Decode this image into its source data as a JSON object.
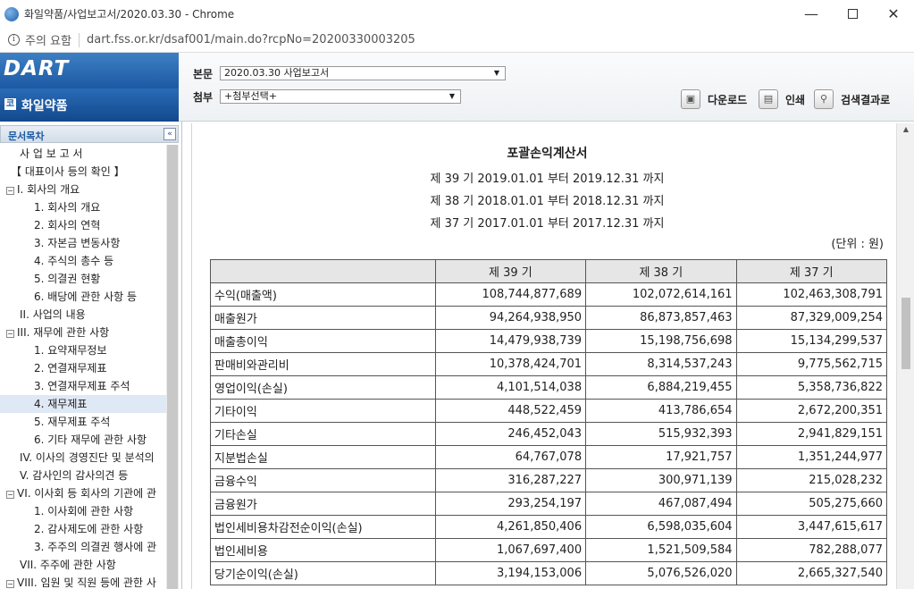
{
  "browser": {
    "title": "화일약품/사업보고서/2020.03.30 - Chrome",
    "security_label": "주의 요함",
    "url": "dart.fss.or.kr/dsaf001/main.do?rcpNo=20200330003205"
  },
  "header": {
    "logo": "DART",
    "company": "화일약품",
    "body_label": "본문",
    "body_select": "2020.03.30 사업보고서",
    "attach_label": "첨부",
    "attach_select": "+첨부선택+",
    "download": "다운로드",
    "print": "인쇄",
    "search_results": "검색결과로"
  },
  "sidebar": {
    "title": "문서목차",
    "items": [
      {
        "label": "사 업 보 고 서",
        "box": ""
      },
      {
        "label": "【 대표이사 등의 확인 】",
        "box": ""
      },
      {
        "label": "I. 회사의 개요",
        "box": "−"
      },
      {
        "label": "1. 회사의 개요",
        "box": ""
      },
      {
        "label": "2. 회사의 연혁",
        "box": ""
      },
      {
        "label": "3. 자본금 변동사항",
        "box": ""
      },
      {
        "label": "4. 주식의 총수 등",
        "box": ""
      },
      {
        "label": "5. 의결권 현황",
        "box": ""
      },
      {
        "label": "6. 배당에 관한 사항 등",
        "box": ""
      },
      {
        "label": "II. 사업의 내용",
        "box": ""
      },
      {
        "label": "III. 재무에 관한 사항",
        "box": "−"
      },
      {
        "label": "1. 요약재무정보",
        "box": ""
      },
      {
        "label": "2. 연결재무제표",
        "box": ""
      },
      {
        "label": "3. 연결재무제표 주석",
        "box": ""
      },
      {
        "label": "4. 재무제표",
        "box": ""
      },
      {
        "label": "5. 재무제표 주석",
        "box": ""
      },
      {
        "label": "6. 기타 재무에 관한 사항",
        "box": ""
      },
      {
        "label": "IV. 이사의 경영진단 및 분석의",
        "box": ""
      },
      {
        "label": "V. 감사인의 감사의견 등",
        "box": ""
      },
      {
        "label": "VI. 이사회 등 회사의 기관에 관",
        "box": "−"
      },
      {
        "label": "1. 이사회에 관한 사항",
        "box": ""
      },
      {
        "label": "2. 감사제도에 관한 사항",
        "box": ""
      },
      {
        "label": "3. 주주의 의결권 행사에 관",
        "box": ""
      },
      {
        "label": "VII. 주주에 관한 사항",
        "box": ""
      },
      {
        "label": "VIII. 임원 및 직원 등에 관한 사",
        "box": "−"
      }
    ]
  },
  "document": {
    "title": "포괄손익계산서",
    "periods": [
      "제 39 기 2019.01.01 부터 2019.12.31 까지",
      "제 38 기 2018.01.01 부터 2018.12.31 까지",
      "제 37 기 2017.01.01 부터 2017.12.31 까지"
    ],
    "unit": "(단위 : 원)",
    "columns": [
      "",
      "제 39 기",
      "제 38 기",
      "제 37 기"
    ],
    "rows": [
      [
        "수익(매출액)",
        "108,744,877,689",
        "102,072,614,161",
        "102,463,308,791"
      ],
      [
        "매출원가",
        "94,264,938,950",
        "86,873,857,463",
        "87,329,009,254"
      ],
      [
        "매출총이익",
        "14,479,938,739",
        "15,198,756,698",
        "15,134,299,537"
      ],
      [
        "판매비와관리비",
        "10,378,424,701",
        "8,314,537,243",
        "9,775,562,715"
      ],
      [
        "영업이익(손실)",
        "4,101,514,038",
        "6,884,219,455",
        "5,358,736,822"
      ],
      [
        "기타이익",
        "448,522,459",
        "413,786,654",
        "2,672,200,351"
      ],
      [
        "기타손실",
        "246,452,043",
        "515,932,393",
        "2,941,829,151"
      ],
      [
        "지분법손실",
        "64,767,078",
        "17,921,757",
        "1,351,244,977"
      ],
      [
        "금융수익",
        "316,287,227",
        "300,971,139",
        "215,028,232"
      ],
      [
        "금융원가",
        "293,254,197",
        "467,087,494",
        "505,275,660"
      ],
      [
        "법인세비용차감전순이익(손실)",
        "4,261,850,406",
        "6,598,035,604",
        "3,447,615,617"
      ],
      [
        "법인세비용",
        "1,067,697,400",
        "1,521,509,584",
        "782,288,077"
      ],
      [
        "당기순이익(손실)",
        "3,194,153,006",
        "5,076,526,020",
        "2,665,327,540"
      ]
    ]
  }
}
